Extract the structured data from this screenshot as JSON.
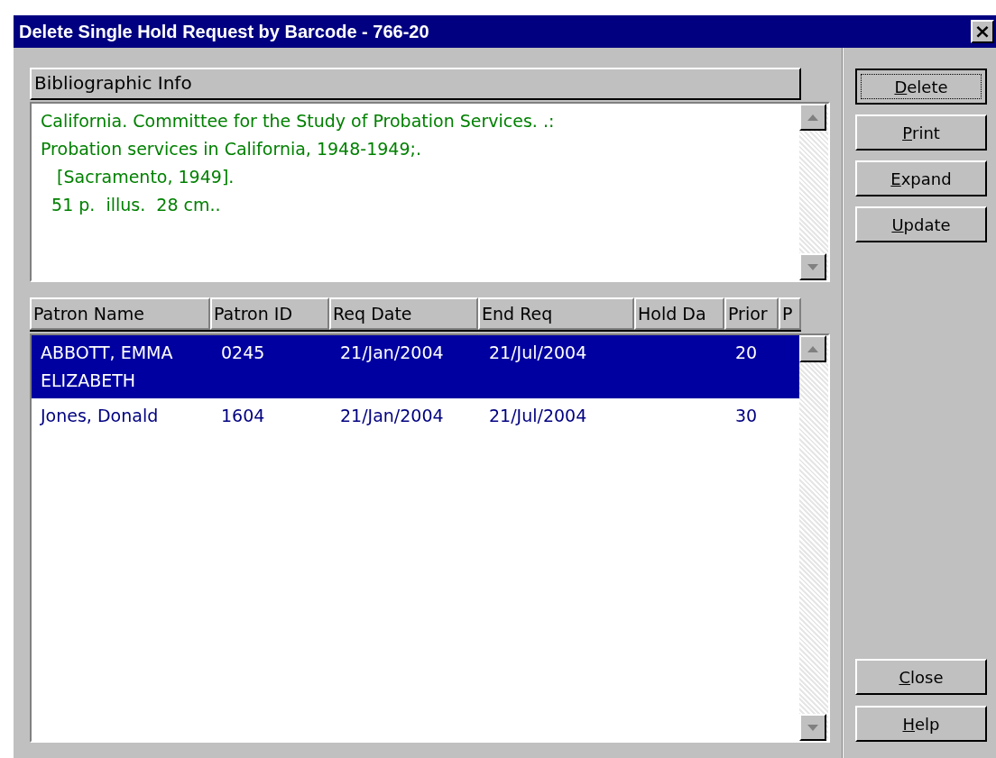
{
  "window": {
    "title": "Delete Single Hold Request by Barcode - 766-20",
    "close": "×"
  },
  "bibliographic": {
    "heading": "Bibliographic Info",
    "lines": [
      "California. Committee for the Study of Probation Services. .:",
      "Probation services in California, 1948-1949;.",
      "   [Sacramento, 1949].",
      "  51 p.  illus.  28 cm.."
    ]
  },
  "table": {
    "columns": [
      "Patron Name",
      "Patron ID",
      "Req Date",
      "End Req",
      "Hold Da",
      "Prior",
      "P"
    ],
    "rows": [
      {
        "selected": true,
        "cells": [
          "ABBOTT, EMMA ELIZABETH",
          "0245",
          "21/Jan/2004",
          "21/Jul/2004",
          "",
          "20"
        ]
      },
      {
        "selected": false,
        "cells": [
          "Jones, Donald",
          "1604",
          "21/Jan/2004",
          "21/Jul/2004",
          "",
          "30"
        ]
      }
    ]
  },
  "buttons_top": [
    {
      "key": "D",
      "rest": "elete",
      "focused": true
    },
    {
      "key": "P",
      "rest": "rint",
      "focused": false
    },
    {
      "key": "E",
      "rest": "xpand",
      "focused": false
    },
    {
      "key": "U",
      "rest": "pdate",
      "focused": false
    }
  ],
  "buttons_bottom": [
    {
      "key": "C",
      "rest": "lose",
      "focused": false
    },
    {
      "key": "H",
      "rest": "elp",
      "focused": false
    }
  ]
}
